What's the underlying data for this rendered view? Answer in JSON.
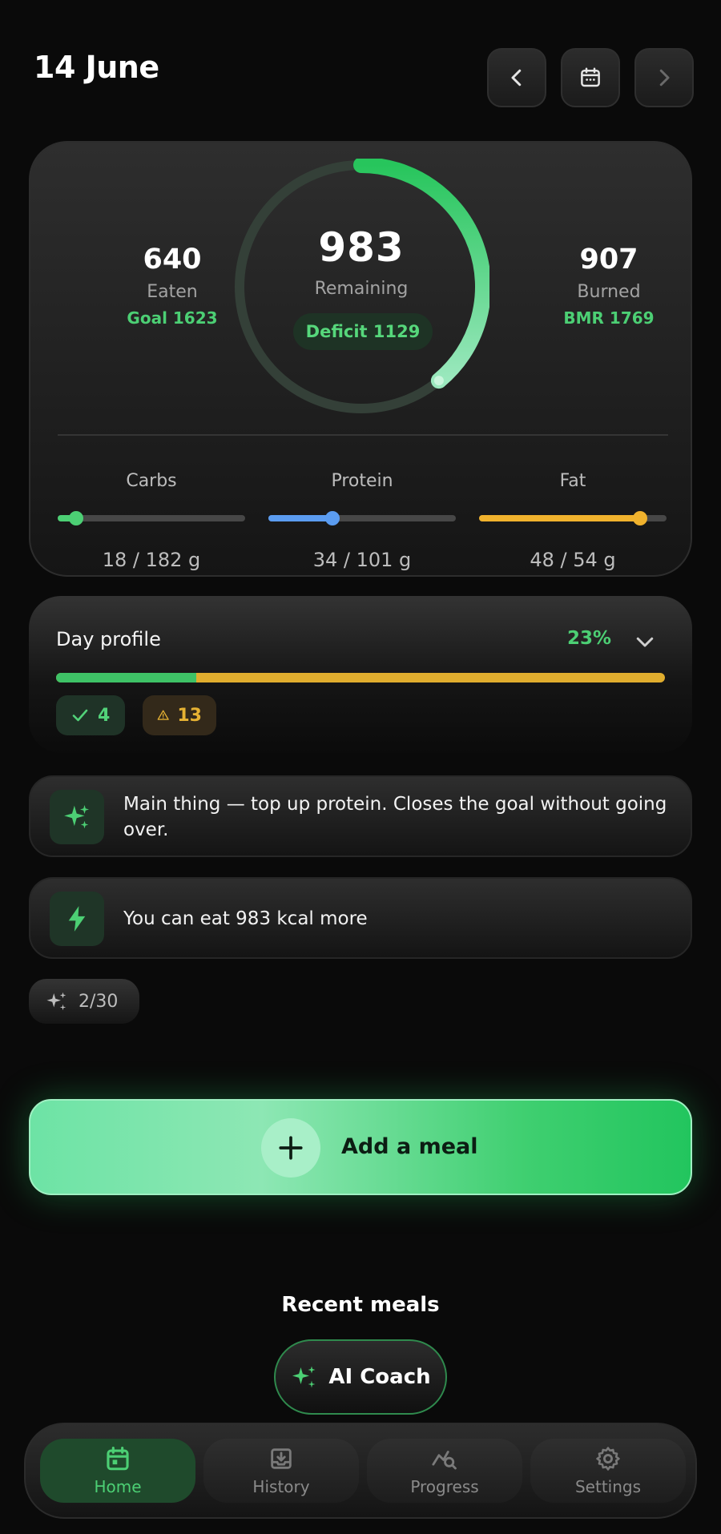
{
  "header": {
    "date": "14 June"
  },
  "summary": {
    "eaten": {
      "value": "640",
      "label": "Eaten",
      "sub": "Goal 1623"
    },
    "burned": {
      "value": "907",
      "label": "Burned",
      "sub": "BMR 1769"
    },
    "remaining": {
      "value": "983",
      "label": "Remaining",
      "deficit": "Deficit 1129",
      "progress": 0.39
    },
    "macros": [
      {
        "name": "Carbs",
        "value": "18 / 182 g",
        "progress": 0.1,
        "color": "#4ccf74"
      },
      {
        "name": "Protein",
        "value": "34 / 101 g",
        "progress": 0.34,
        "color": "#5b9cf0"
      },
      {
        "name": "Fat",
        "value": "48 / 54 g",
        "progress": 0.86,
        "color": "#f0b22d"
      }
    ]
  },
  "profile": {
    "title": "Day profile",
    "percent": "23%",
    "progress": 0.23,
    "ok_count": "4",
    "warn_count": "13"
  },
  "tips": [
    {
      "icon": "sparkles-icon",
      "text": "Main thing — top up protein. Closes the goal without going over."
    },
    {
      "icon": "lightning-icon",
      "text": "You can eat 983 kcal more"
    }
  ],
  "quota": {
    "text": "2/30"
  },
  "add_meal": {
    "label": "Add a meal"
  },
  "recent": {
    "title": "Recent meals"
  },
  "coach": {
    "label": "AI Coach"
  },
  "nav": [
    {
      "label": "Home",
      "icon": "calendar-icon",
      "active": true
    },
    {
      "label": "History",
      "icon": "inbox-icon",
      "active": false
    },
    {
      "label": "Progress",
      "icon": "chart-search-icon",
      "active": false
    },
    {
      "label": "Settings",
      "icon": "gear-icon",
      "active": false
    }
  ],
  "colors": {
    "accent": "#4ccf74",
    "warning": "#e6b233",
    "background": "#0a0a0a"
  }
}
